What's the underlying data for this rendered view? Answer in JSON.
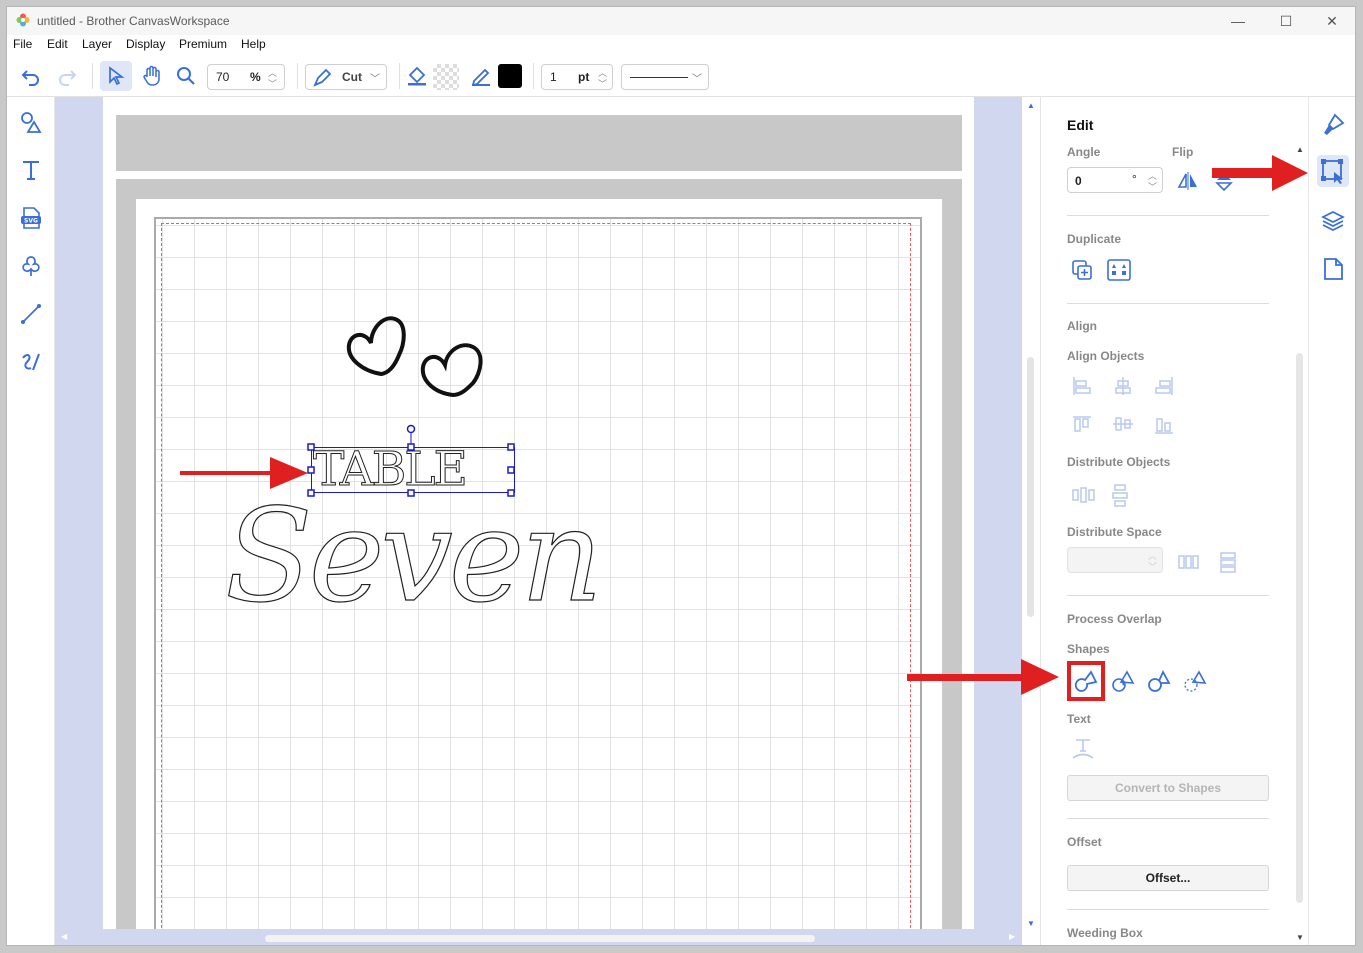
{
  "window": {
    "title": "untitled - Brother CanvasWorkspace",
    "minimize": "—",
    "maximize": "☐",
    "close": "✕"
  },
  "menu": [
    "File",
    "Edit",
    "Layer",
    "Display",
    "Premium",
    "Help"
  ],
  "toolbar": {
    "zoom_value": "70",
    "zoom_unit": "%",
    "mode_label": "Cut",
    "line_width_value": "1",
    "line_width_unit": "pt",
    "fill_color": "#000000"
  },
  "left_tools": [
    "shapes-icon",
    "text-icon",
    "svg-import-icon",
    "pattern-icon",
    "line-icon",
    "freehand-icon"
  ],
  "canvas": {
    "selected_text": "TABLE",
    "main_text": "Seven",
    "colors": {
      "selection": "#1a1acc",
      "cut_line": "#e06060",
      "background": "#d1d7ee"
    }
  },
  "panel": {
    "heading": "Edit",
    "angle_label": "Angle",
    "angle_value": "0",
    "angle_unit": "°",
    "flip_label": "Flip",
    "duplicate_label": "Duplicate",
    "align_label": "Align",
    "align_objects_label": "Align Objects",
    "distribute_objects_label": "Distribute Objects",
    "distribute_space_label": "Distribute Space",
    "process_overlap_label": "Process Overlap",
    "shapes_label": "Shapes",
    "text_label": "Text",
    "convert_button": "Convert to Shapes",
    "offset_label": "Offset",
    "offset_button": "Offset...",
    "weeding_label": "Weeding Box",
    "accent_color": "#3a6fd8",
    "disabled_color": "#b9c8ee"
  },
  "right_strip": [
    "paint-brush-icon",
    "edit-transform-icon",
    "layers-icon",
    "page-icon"
  ],
  "annotations": {
    "arrow_color": "#e02020",
    "highlight_color": "#e02020"
  }
}
